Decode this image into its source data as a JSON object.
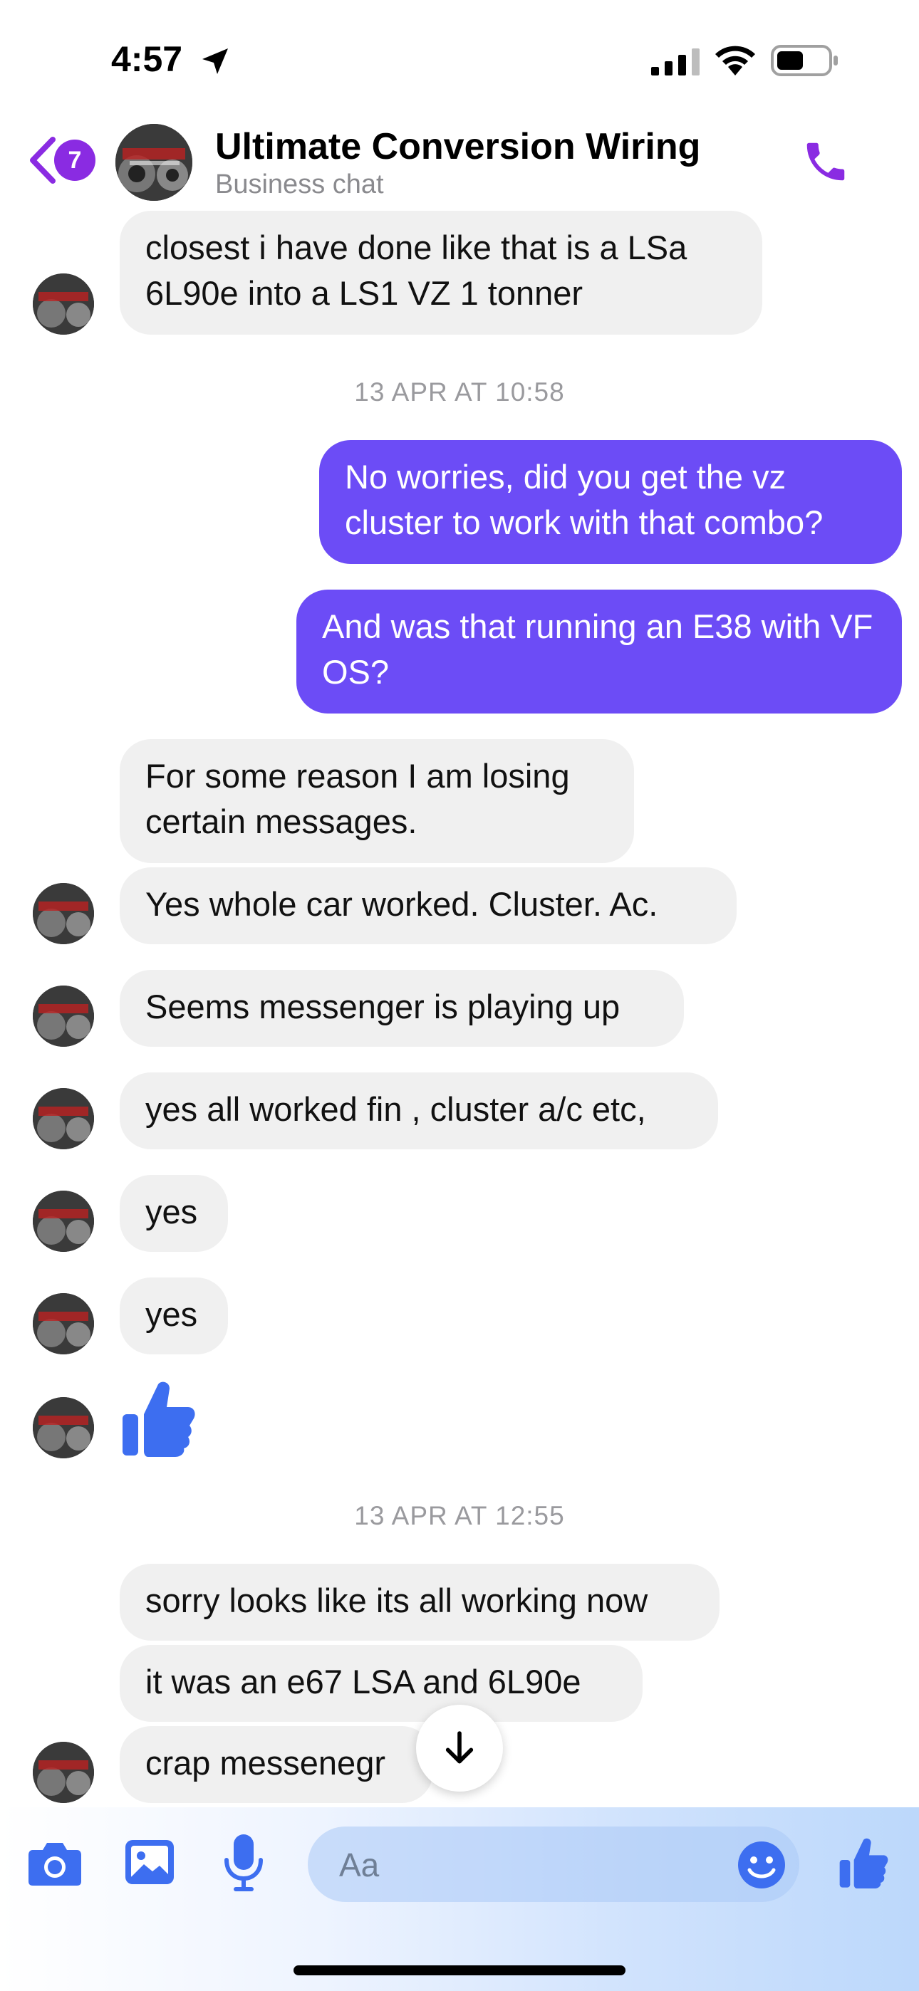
{
  "status_bar": {
    "time": "4:57"
  },
  "header": {
    "back_badge": "7",
    "contact_name": "Ultimate Conversion Wiring",
    "contact_subtitle": "Business chat"
  },
  "messages": {
    "m1": "closest i have done like that is a LSa 6L90e into a LS1 VZ 1 tonner",
    "ts1": "13 APR AT 10:58",
    "m2": "No worries, did you get the vz cluster to work with that combo?",
    "m3": "And was that running an E38 with VF OS?",
    "m4": "For some reason I am losing certain messages.",
    "m5": "Yes whole car worked.  Cluster. Ac.",
    "m6": "Seems messenger is playing up",
    "m7": "yes all worked fin , cluster a/c etc,",
    "m8": "yes",
    "m9": "yes",
    "ts2": "13 APR AT 12:55",
    "m11": "sorry looks like its all working now",
    "m12": "it was an e67 LSA and 6L90e",
    "m13": "crap messenegr"
  },
  "composer": {
    "placeholder": "Aa"
  },
  "colors": {
    "accent": "#8a2be2",
    "outgoing": "#6c4cf6",
    "incoming": "#f0f0f0",
    "icon_blue": "#3d6ef0"
  }
}
